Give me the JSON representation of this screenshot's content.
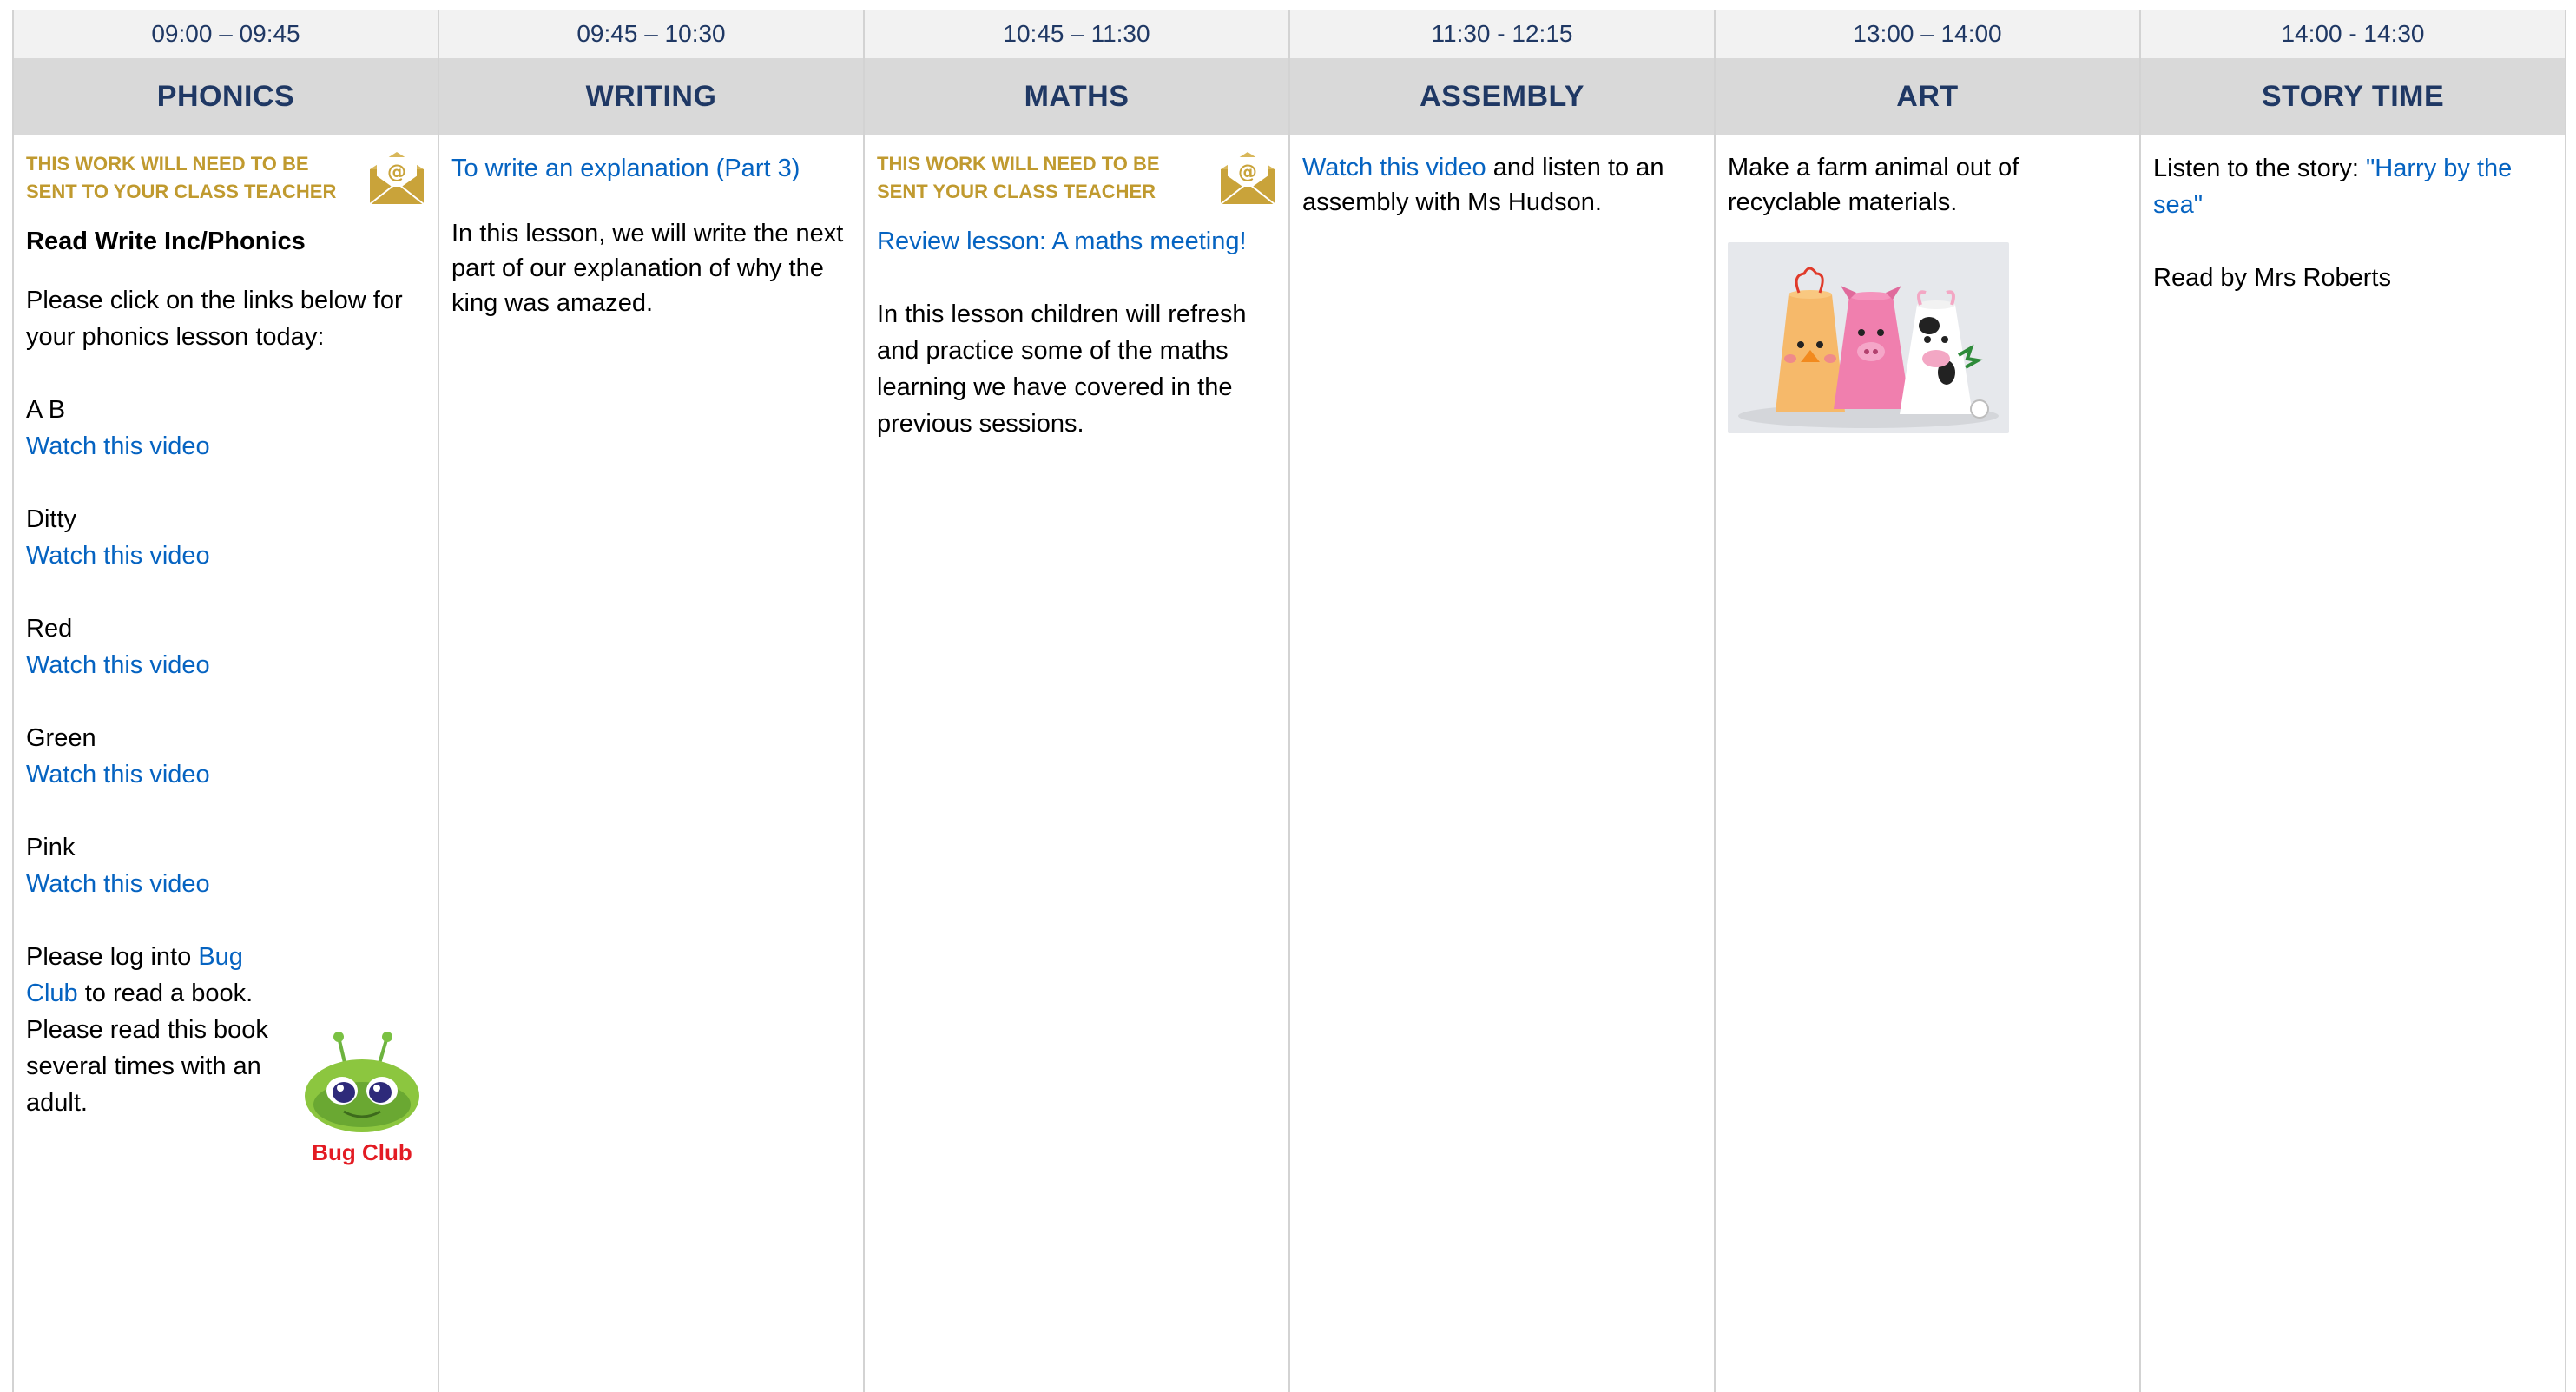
{
  "columns": [
    {
      "time": "09:00 – 09:45",
      "subject": "PHONICS"
    },
    {
      "time": "09:45 – 10:30",
      "subject": "WRITING"
    },
    {
      "time": "10:45 – 11:30",
      "subject": "MATHS"
    },
    {
      "time": "11:30 - 12:15",
      "subject": "ASSEMBLY"
    },
    {
      "time": "13:00 – 14:00",
      "subject": "ART"
    },
    {
      "time": "14:00 - 14:30",
      "subject": "STORY TIME"
    }
  ],
  "phonics": {
    "notice": "THIS WORK WILL NEED TO BE SENT TO YOUR CLASS TEACHER",
    "heading": "Read Write Inc/Phonics",
    "intro": "Please click on the links below for your phonics lesson today:",
    "sets": [
      {
        "name": "A B",
        "link": "Watch this video"
      },
      {
        "name": "Ditty",
        "link": "Watch this video"
      },
      {
        "name": "Red",
        "link": "Watch this video"
      },
      {
        "name": "Green",
        "link": "Watch this video"
      },
      {
        "name": "Pink",
        "link": "Watch this video"
      }
    ],
    "bug_pre": "Please log into ",
    "bug_link": "Bug Club",
    "bug_post": " to read a book. Please read this book several times with an adult.",
    "bug_logo_text": "Bug Club"
  },
  "writing": {
    "link": "To write an explanation (Part 3)",
    "text": "In this lesson, we will write the next part of our explanation of why the king was amazed."
  },
  "maths": {
    "notice": "THIS WORK WILL NEED TO BE SENT YOUR CLASS TEACHER",
    "link": "Review lesson: A maths meeting!",
    "text": "In this lesson children will refresh and practice some of the maths learning we have covered in the previous sessions."
  },
  "assembly": {
    "link": "Watch this video",
    "text": " and listen to an assembly with Ms Hudson."
  },
  "art": {
    "text": "Make a farm animal out of recyclable materials."
  },
  "story": {
    "pre": "Listen to the story: ",
    "link": "\"Harry by the sea\"",
    "reader": "Read by Mrs Roberts"
  },
  "colors": {
    "header_text": "#1f3864",
    "link": "#0563c1",
    "notice": "#c09a2f",
    "time_bg": "#f2f2f2",
    "subject_bg": "#d9d9d9"
  }
}
